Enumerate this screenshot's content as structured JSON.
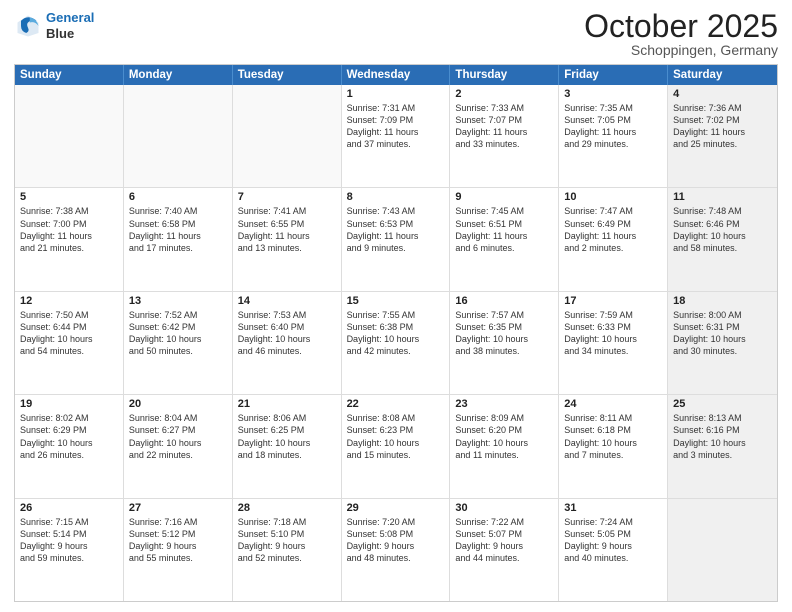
{
  "logo": {
    "line1": "General",
    "line2": "Blue"
  },
  "title": "October 2025",
  "subtitle": "Schoppingen, Germany",
  "days": [
    "Sunday",
    "Monday",
    "Tuesday",
    "Wednesday",
    "Thursday",
    "Friday",
    "Saturday"
  ],
  "rows": [
    [
      {
        "day": "",
        "text": "",
        "empty": true
      },
      {
        "day": "",
        "text": "",
        "empty": true
      },
      {
        "day": "",
        "text": "",
        "empty": true
      },
      {
        "day": "1",
        "text": "Sunrise: 7:31 AM\nSunset: 7:09 PM\nDaylight: 11 hours\nand 37 minutes."
      },
      {
        "day": "2",
        "text": "Sunrise: 7:33 AM\nSunset: 7:07 PM\nDaylight: 11 hours\nand 33 minutes."
      },
      {
        "day": "3",
        "text": "Sunrise: 7:35 AM\nSunset: 7:05 PM\nDaylight: 11 hours\nand 29 minutes."
      },
      {
        "day": "4",
        "text": "Sunrise: 7:36 AM\nSunset: 7:02 PM\nDaylight: 11 hours\nand 25 minutes.",
        "shaded": true
      }
    ],
    [
      {
        "day": "5",
        "text": "Sunrise: 7:38 AM\nSunset: 7:00 PM\nDaylight: 11 hours\nand 21 minutes."
      },
      {
        "day": "6",
        "text": "Sunrise: 7:40 AM\nSunset: 6:58 PM\nDaylight: 11 hours\nand 17 minutes."
      },
      {
        "day": "7",
        "text": "Sunrise: 7:41 AM\nSunset: 6:55 PM\nDaylight: 11 hours\nand 13 minutes."
      },
      {
        "day": "8",
        "text": "Sunrise: 7:43 AM\nSunset: 6:53 PM\nDaylight: 11 hours\nand 9 minutes."
      },
      {
        "day": "9",
        "text": "Sunrise: 7:45 AM\nSunset: 6:51 PM\nDaylight: 11 hours\nand 6 minutes."
      },
      {
        "day": "10",
        "text": "Sunrise: 7:47 AM\nSunset: 6:49 PM\nDaylight: 11 hours\nand 2 minutes."
      },
      {
        "day": "11",
        "text": "Sunrise: 7:48 AM\nSunset: 6:46 PM\nDaylight: 10 hours\nand 58 minutes.",
        "shaded": true
      }
    ],
    [
      {
        "day": "12",
        "text": "Sunrise: 7:50 AM\nSunset: 6:44 PM\nDaylight: 10 hours\nand 54 minutes."
      },
      {
        "day": "13",
        "text": "Sunrise: 7:52 AM\nSunset: 6:42 PM\nDaylight: 10 hours\nand 50 minutes."
      },
      {
        "day": "14",
        "text": "Sunrise: 7:53 AM\nSunset: 6:40 PM\nDaylight: 10 hours\nand 46 minutes."
      },
      {
        "day": "15",
        "text": "Sunrise: 7:55 AM\nSunset: 6:38 PM\nDaylight: 10 hours\nand 42 minutes."
      },
      {
        "day": "16",
        "text": "Sunrise: 7:57 AM\nSunset: 6:35 PM\nDaylight: 10 hours\nand 38 minutes."
      },
      {
        "day": "17",
        "text": "Sunrise: 7:59 AM\nSunset: 6:33 PM\nDaylight: 10 hours\nand 34 minutes."
      },
      {
        "day": "18",
        "text": "Sunrise: 8:00 AM\nSunset: 6:31 PM\nDaylight: 10 hours\nand 30 minutes.",
        "shaded": true
      }
    ],
    [
      {
        "day": "19",
        "text": "Sunrise: 8:02 AM\nSunset: 6:29 PM\nDaylight: 10 hours\nand 26 minutes."
      },
      {
        "day": "20",
        "text": "Sunrise: 8:04 AM\nSunset: 6:27 PM\nDaylight: 10 hours\nand 22 minutes."
      },
      {
        "day": "21",
        "text": "Sunrise: 8:06 AM\nSunset: 6:25 PM\nDaylight: 10 hours\nand 18 minutes."
      },
      {
        "day": "22",
        "text": "Sunrise: 8:08 AM\nSunset: 6:23 PM\nDaylight: 10 hours\nand 15 minutes."
      },
      {
        "day": "23",
        "text": "Sunrise: 8:09 AM\nSunset: 6:20 PM\nDaylight: 10 hours\nand 11 minutes."
      },
      {
        "day": "24",
        "text": "Sunrise: 8:11 AM\nSunset: 6:18 PM\nDaylight: 10 hours\nand 7 minutes."
      },
      {
        "day": "25",
        "text": "Sunrise: 8:13 AM\nSunset: 6:16 PM\nDaylight: 10 hours\nand 3 minutes.",
        "shaded": true
      }
    ],
    [
      {
        "day": "26",
        "text": "Sunrise: 7:15 AM\nSunset: 5:14 PM\nDaylight: 9 hours\nand 59 minutes."
      },
      {
        "day": "27",
        "text": "Sunrise: 7:16 AM\nSunset: 5:12 PM\nDaylight: 9 hours\nand 55 minutes."
      },
      {
        "day": "28",
        "text": "Sunrise: 7:18 AM\nSunset: 5:10 PM\nDaylight: 9 hours\nand 52 minutes."
      },
      {
        "day": "29",
        "text": "Sunrise: 7:20 AM\nSunset: 5:08 PM\nDaylight: 9 hours\nand 48 minutes."
      },
      {
        "day": "30",
        "text": "Sunrise: 7:22 AM\nSunset: 5:07 PM\nDaylight: 9 hours\nand 44 minutes."
      },
      {
        "day": "31",
        "text": "Sunrise: 7:24 AM\nSunset: 5:05 PM\nDaylight: 9 hours\nand 40 minutes."
      },
      {
        "day": "",
        "text": "",
        "empty": true,
        "shaded": true
      }
    ]
  ]
}
